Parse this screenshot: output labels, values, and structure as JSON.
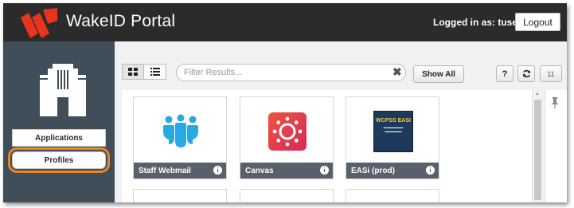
{
  "header": {
    "title": "WakeID Portal",
    "login_label": "Logged in as:",
    "username": "tuser",
    "logout_label": "Logout",
    "brand_color": "#e8331f"
  },
  "sidebar": {
    "items": [
      {
        "label": "Applications",
        "icon": "applications"
      },
      {
        "label": "Profiles",
        "icon": "profiles",
        "highlighted": true
      }
    ],
    "highlight_color": "#ee8322"
  },
  "toolbar": {
    "grid_view_icon": "grid-view-icon",
    "list_view_icon": "list-view-icon",
    "filter_placeholder": "Filter Results...",
    "clear_icon": "✖",
    "show_all_label": "Show All",
    "help_label": "?",
    "refresh_icon": "refresh-icon",
    "count_label": "11"
  },
  "apps": [
    {
      "label": "Staff Webmail",
      "icon": "staff-webmail-icon",
      "info": "i"
    },
    {
      "label": "Canvas",
      "icon": "canvas-icon",
      "info": "i"
    },
    {
      "label": "EASi (prod)",
      "icon": "easi-icon",
      "info": "i",
      "logo_title": "WCPSS EASI"
    }
  ]
}
